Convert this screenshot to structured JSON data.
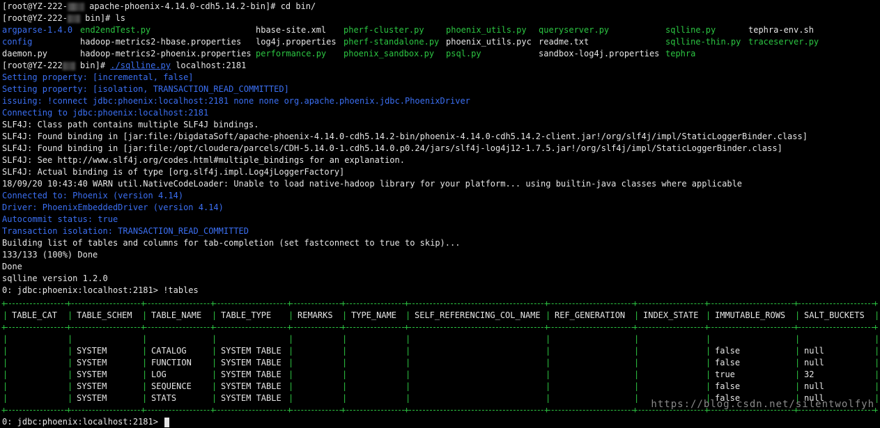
{
  "cmd1": {
    "prompt_a": "[root@YZ-222-",
    "prompt_b": " apache-phoenix-4.14.0-cdh5.14.2-bin]# ",
    "command": "cd bin/"
  },
  "cmd2": {
    "prompt_a": "[root@YZ-222-",
    "prompt_b": " bin]# ",
    "command": "ls"
  },
  "ls_rows": [
    [
      {
        "text": "argparse-1.4.0",
        "color": "blue"
      },
      {
        "text": "end2endTest.py",
        "color": "green"
      },
      {
        "text": "hbase-site.xml",
        "color": "default"
      },
      {
        "text": "pherf-cluster.py",
        "color": "green"
      },
      {
        "text": "phoenix_utils.py",
        "color": "green"
      },
      {
        "text": "queryserver.py",
        "color": "green"
      },
      {
        "text": "sqlline.py",
        "color": "green"
      },
      {
        "text": "tephra-env.sh",
        "color": "default"
      }
    ],
    [
      {
        "text": "config",
        "color": "blue"
      },
      {
        "text": "hadoop-metrics2-hbase.properties",
        "color": "default"
      },
      {
        "text": "log4j.properties",
        "color": "default"
      },
      {
        "text": "pherf-standalone.py",
        "color": "green"
      },
      {
        "text": "phoenix_utils.pyc",
        "color": "default"
      },
      {
        "text": "readme.txt",
        "color": "default"
      },
      {
        "text": "sqlline-thin.py",
        "color": "green"
      },
      {
        "text": "traceserver.py",
        "color": "green"
      }
    ],
    [
      {
        "text": "daemon.py",
        "color": "default"
      },
      {
        "text": "hadoop-metrics2-phoenix.properties",
        "color": "default"
      },
      {
        "text": "performance.py",
        "color": "green"
      },
      {
        "text": "phoenix_sandbox.py",
        "color": "green"
      },
      {
        "text": "psql.py",
        "color": "green"
      },
      {
        "text": "sandbox-log4j.properties",
        "color": "default"
      },
      {
        "text": "tephra",
        "color": "green"
      },
      {
        "text": "",
        "color": "default"
      }
    ]
  ],
  "cmd3": {
    "prompt_a": "[root@YZ-222",
    "prompt_b": " bin]# ",
    "script": "./sqlline.py",
    "args": " localhost:2181"
  },
  "output_lines": [
    {
      "text": "Setting property: [incremental, false]",
      "color": "blue"
    },
    {
      "text": "Setting property: [isolation, TRANSACTION_READ_COMMITTED]",
      "color": "blue"
    },
    {
      "text": "issuing: !connect jdbc:phoenix:localhost:2181 none none org.apache.phoenix.jdbc.PhoenixDriver",
      "color": "blue"
    },
    {
      "text": "Connecting to jdbc:phoenix:localhost:2181",
      "color": "blue"
    },
    {
      "text": "SLF4J: Class path contains multiple SLF4J bindings.",
      "color": "default"
    },
    {
      "text": "SLF4J: Found binding in [jar:file:/bigdataSoft/apache-phoenix-4.14.0-cdh5.14.2-bin/phoenix-4.14.0-cdh5.14.2-client.jar!/org/slf4j/impl/StaticLoggerBinder.class]",
      "color": "default"
    },
    {
      "text": "SLF4J: Found binding in [jar:file:/opt/cloudera/parcels/CDH-5.14.0-1.cdh5.14.0.p0.24/jars/slf4j-log4j12-1.7.5.jar!/org/slf4j/impl/StaticLoggerBinder.class]",
      "color": "default"
    },
    {
      "text": "SLF4J: See http://www.slf4j.org/codes.html#multiple_bindings for an explanation.",
      "color": "default"
    },
    {
      "text": "SLF4J: Actual binding is of type [org.slf4j.impl.Log4jLoggerFactory]",
      "color": "default"
    },
    {
      "text": "18/09/20 10:43:40 WARN util.NativeCodeLoader: Unable to load native-hadoop library for your platform... using builtin-java classes where applicable",
      "color": "default"
    },
    {
      "text": "Connected to: Phoenix (version 4.14)",
      "color": "blue"
    },
    {
      "text": "Driver: PhoenixEmbeddedDriver (version 4.14)",
      "color": "blue"
    },
    {
      "text": "Autocommit status: true",
      "color": "blue"
    },
    {
      "text": "Transaction isolation: TRANSACTION_READ_COMMITTED",
      "color": "blue"
    },
    {
      "text": "Building list of tables and columns for tab-completion (set fastconnect to true to skip)...",
      "color": "default"
    },
    {
      "text": "133/133 (100%) Done",
      "color": "default"
    },
    {
      "text": "Done",
      "color": "default"
    },
    {
      "text": "sqlline version 1.2.0",
      "color": "default"
    },
    {
      "text": "0: jdbc:phoenix:localhost:2181> !tables",
      "color": "default"
    }
  ],
  "table": {
    "headers": [
      "TABLE_CAT",
      "TABLE_SCHEM",
      "TABLE_NAME",
      "TABLE_TYPE",
      "REMARKS",
      "TYPE_NAME",
      "SELF_REFERENCING_COL_NAME",
      "REF_GENERATION",
      "INDEX_STATE",
      "IMMUTABLE_ROWS",
      "SALT_BUCKETS"
    ],
    "rows": [
      [
        "",
        "",
        "",
        "",
        "",
        "",
        "",
        "",
        "",
        "",
        ""
      ],
      [
        "",
        "SYSTEM",
        "CATALOG",
        "SYSTEM TABLE",
        "",
        "",
        "",
        "",
        "",
        "false",
        "null"
      ],
      [
        "",
        "SYSTEM",
        "FUNCTION",
        "SYSTEM TABLE",
        "",
        "",
        "",
        "",
        "",
        "false",
        "null"
      ],
      [
        "",
        "SYSTEM",
        "LOG",
        "SYSTEM TABLE",
        "",
        "",
        "",
        "",
        "",
        "true",
        "32"
      ],
      [
        "",
        "SYSTEM",
        "SEQUENCE",
        "SYSTEM TABLE",
        "",
        "",
        "",
        "",
        "",
        "false",
        "null"
      ],
      [
        "",
        "SYSTEM",
        "STATS",
        "SYSTEM TABLE",
        "",
        "",
        "",
        "",
        "",
        "false",
        "null"
      ]
    ]
  },
  "final_prompt": "0: jdbc:phoenix:localhost:2181> ",
  "watermark": "https://blog.csdn.net/silentwolfyh",
  "colors": {
    "green": "#2cc542",
    "blue": "#3b6ff2",
    "default": "#e6e6e6",
    "background": "#000000"
  }
}
